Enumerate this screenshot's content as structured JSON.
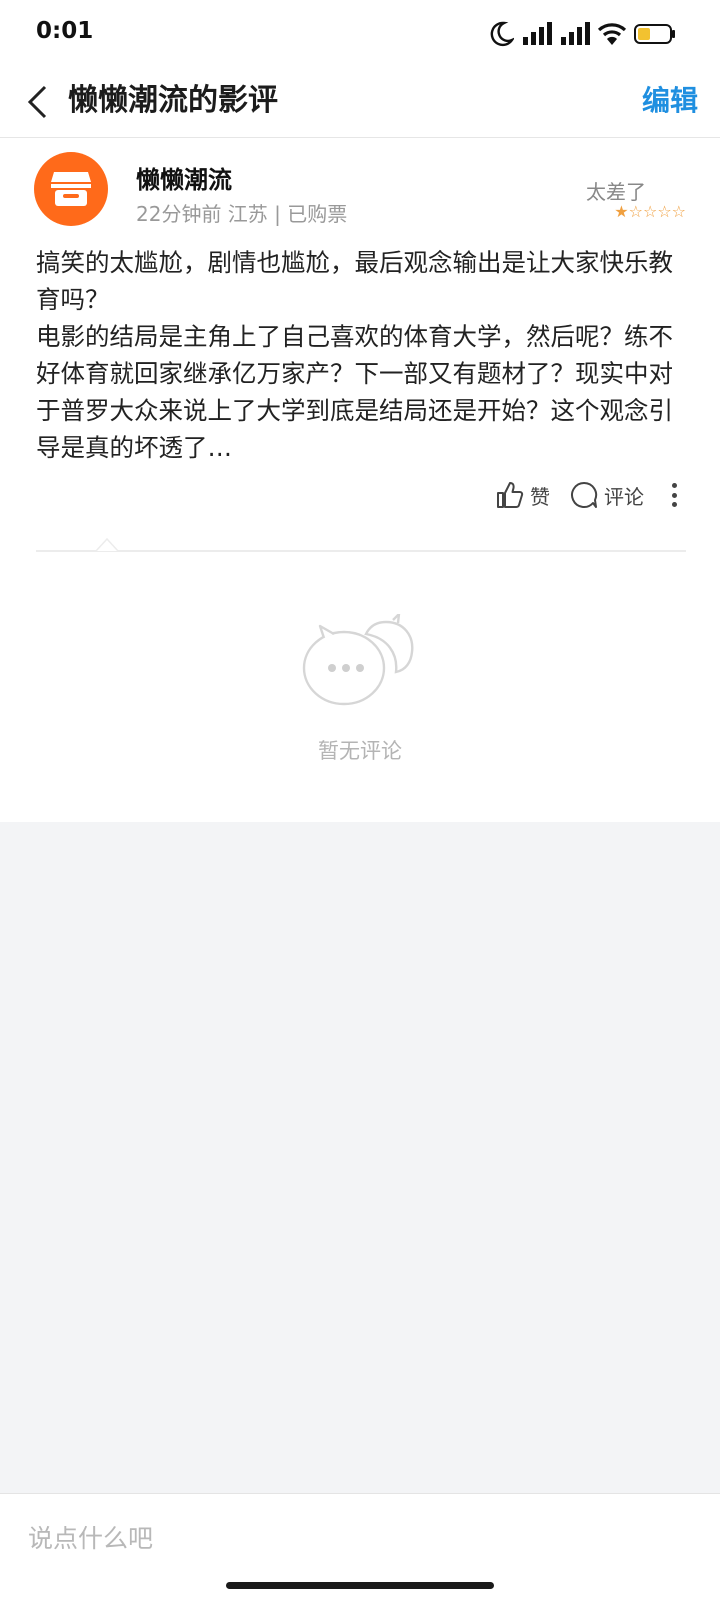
{
  "status_bar": {
    "time": "0:01",
    "icons": [
      "moon-icon",
      "signal-icon",
      "signal-icon",
      "wifi-icon",
      "battery-icon"
    ]
  },
  "header": {
    "title": "懒懒潮流的影评",
    "edit_label": "编辑"
  },
  "review": {
    "username": "懒懒潮流",
    "meta": "22分钟前 江苏 | 已购票",
    "rating_text": "太差了",
    "rating_stars": 1,
    "rating_max": 5,
    "lines": [
      "搞笑的太尴尬，剧情也尴尬，最后观念输出是让大家快乐教育吗？",
      "电影的结局是主角上了自己喜欢的体育大学，然后呢？练不好体育就回家继承亿万家产？下一部又有题材了？现实中对于普罗大众来说上了大学到底是结局还是开始？这个观念引导是真的坏透了…"
    ],
    "like_label": "赞",
    "comment_label": "评论"
  },
  "comments": {
    "empty_text": "暂无评论"
  },
  "input": {
    "placeholder": "说点什么吧"
  },
  "colors": {
    "accent": "#1f8fe0",
    "avatar_bg": "#ff6a1a",
    "star": "#f0a040"
  }
}
